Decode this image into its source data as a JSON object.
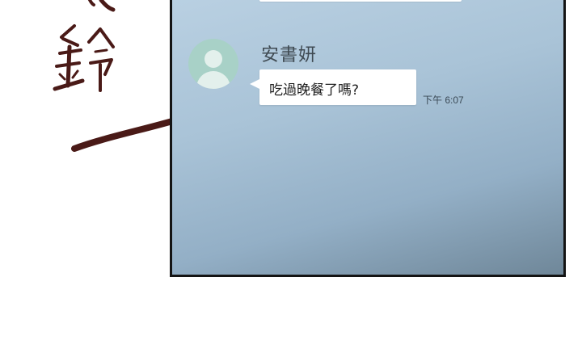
{
  "sfx": {
    "text": "鈴",
    "color": "#4a1a17"
  },
  "chat": {
    "sender_name": "安書妍",
    "message_text": "吃過晚餐了嗎?",
    "timestamp": "下午 6:07",
    "avatar_icon": "default-user-avatar-icon",
    "avatar_color": "#a8d1c7"
  }
}
